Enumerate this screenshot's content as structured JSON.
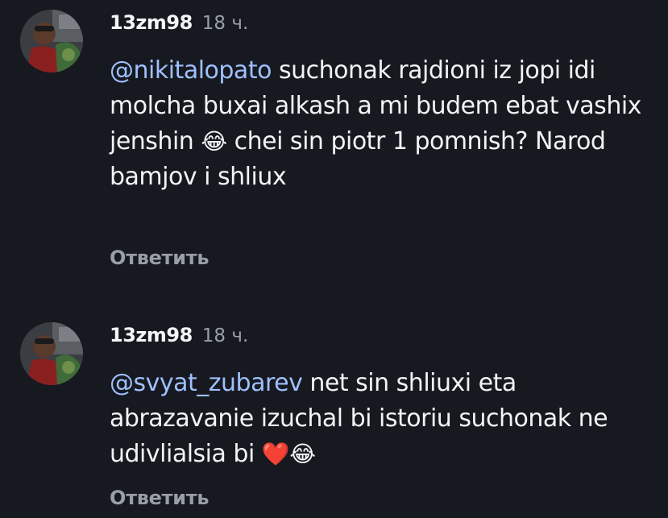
{
  "comments": [
    {
      "username": "13zm98",
      "time": "18 ч.",
      "mention": "@nikitalopato",
      "text": " suchonak rajdioni iz jopi idi molcha buxai alkash a mi budem ebat vashix jenshin ",
      "emoji1": "😂",
      "text2": " chei sin piotr 1 pomnish? Narod bamjov i shliux",
      "reply_label": "Ответить"
    },
    {
      "username": "13zm98",
      "time": "18 ч.",
      "mention": "@svyat_zubarev",
      "text": " net sin shliuxi eta abrazavanie izuchal bi istoriu suchonak ne udivlialsia bi ",
      "emoji1": "❤️",
      "emoji2": "😂",
      "reply_label": "Ответить"
    }
  ]
}
